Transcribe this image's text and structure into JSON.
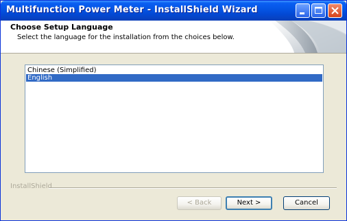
{
  "window": {
    "title": "Multifunction Power Meter - InstallShield Wizard"
  },
  "titlebar_buttons": {
    "minimize_icon": "minimize-icon",
    "maximize_icon": "maximize-icon",
    "close_icon": "close-icon"
  },
  "header": {
    "title": "Choose Setup Language",
    "subtitle": "Select the language for the installation from the choices below."
  },
  "language_list": {
    "items": [
      "Chinese (Simplified)",
      "English"
    ],
    "selected": "English"
  },
  "footer": {
    "brand": "InstallShield",
    "back_label": "< Back",
    "next_label": "Next >",
    "cancel_label": "Cancel"
  },
  "colors": {
    "titlebar": "#0454e3",
    "selection": "#316ac5",
    "dialog_bg": "#ece9d8"
  }
}
